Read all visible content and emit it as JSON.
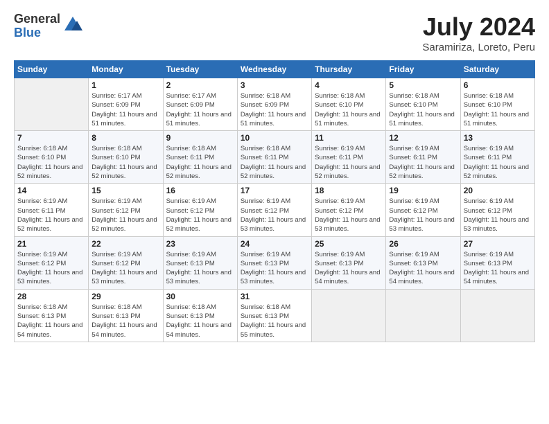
{
  "header": {
    "logo_general": "General",
    "logo_blue": "Blue",
    "month_title": "July 2024",
    "location": "Saramiriza, Loreto, Peru"
  },
  "weekdays": [
    "Sunday",
    "Monday",
    "Tuesday",
    "Wednesday",
    "Thursday",
    "Friday",
    "Saturday"
  ],
  "weeks": [
    [
      {
        "day": "",
        "empty": true
      },
      {
        "day": "1",
        "sunrise": "Sunrise: 6:17 AM",
        "sunset": "Sunset: 6:09 PM",
        "daylight": "Daylight: 11 hours and 51 minutes."
      },
      {
        "day": "2",
        "sunrise": "Sunrise: 6:17 AM",
        "sunset": "Sunset: 6:09 PM",
        "daylight": "Daylight: 11 hours and 51 minutes."
      },
      {
        "day": "3",
        "sunrise": "Sunrise: 6:18 AM",
        "sunset": "Sunset: 6:09 PM",
        "daylight": "Daylight: 11 hours and 51 minutes."
      },
      {
        "day": "4",
        "sunrise": "Sunrise: 6:18 AM",
        "sunset": "Sunset: 6:10 PM",
        "daylight": "Daylight: 11 hours and 51 minutes."
      },
      {
        "day": "5",
        "sunrise": "Sunrise: 6:18 AM",
        "sunset": "Sunset: 6:10 PM",
        "daylight": "Daylight: 11 hours and 51 minutes."
      },
      {
        "day": "6",
        "sunrise": "Sunrise: 6:18 AM",
        "sunset": "Sunset: 6:10 PM",
        "daylight": "Daylight: 11 hours and 51 minutes."
      }
    ],
    [
      {
        "day": "7",
        "sunrise": "Sunrise: 6:18 AM",
        "sunset": "Sunset: 6:10 PM",
        "daylight": "Daylight: 11 hours and 52 minutes."
      },
      {
        "day": "8",
        "sunrise": "Sunrise: 6:18 AM",
        "sunset": "Sunset: 6:10 PM",
        "daylight": "Daylight: 11 hours and 52 minutes."
      },
      {
        "day": "9",
        "sunrise": "Sunrise: 6:18 AM",
        "sunset": "Sunset: 6:11 PM",
        "daylight": "Daylight: 11 hours and 52 minutes."
      },
      {
        "day": "10",
        "sunrise": "Sunrise: 6:18 AM",
        "sunset": "Sunset: 6:11 PM",
        "daylight": "Daylight: 11 hours and 52 minutes."
      },
      {
        "day": "11",
        "sunrise": "Sunrise: 6:19 AM",
        "sunset": "Sunset: 6:11 PM",
        "daylight": "Daylight: 11 hours and 52 minutes."
      },
      {
        "day": "12",
        "sunrise": "Sunrise: 6:19 AM",
        "sunset": "Sunset: 6:11 PM",
        "daylight": "Daylight: 11 hours and 52 minutes."
      },
      {
        "day": "13",
        "sunrise": "Sunrise: 6:19 AM",
        "sunset": "Sunset: 6:11 PM",
        "daylight": "Daylight: 11 hours and 52 minutes."
      }
    ],
    [
      {
        "day": "14",
        "sunrise": "Sunrise: 6:19 AM",
        "sunset": "Sunset: 6:11 PM",
        "daylight": "Daylight: 11 hours and 52 minutes."
      },
      {
        "day": "15",
        "sunrise": "Sunrise: 6:19 AM",
        "sunset": "Sunset: 6:12 PM",
        "daylight": "Daylight: 11 hours and 52 minutes."
      },
      {
        "day": "16",
        "sunrise": "Sunrise: 6:19 AM",
        "sunset": "Sunset: 6:12 PM",
        "daylight": "Daylight: 11 hours and 52 minutes."
      },
      {
        "day": "17",
        "sunrise": "Sunrise: 6:19 AM",
        "sunset": "Sunset: 6:12 PM",
        "daylight": "Daylight: 11 hours and 53 minutes."
      },
      {
        "day": "18",
        "sunrise": "Sunrise: 6:19 AM",
        "sunset": "Sunset: 6:12 PM",
        "daylight": "Daylight: 11 hours and 53 minutes."
      },
      {
        "day": "19",
        "sunrise": "Sunrise: 6:19 AM",
        "sunset": "Sunset: 6:12 PM",
        "daylight": "Daylight: 11 hours and 53 minutes."
      },
      {
        "day": "20",
        "sunrise": "Sunrise: 6:19 AM",
        "sunset": "Sunset: 6:12 PM",
        "daylight": "Daylight: 11 hours and 53 minutes."
      }
    ],
    [
      {
        "day": "21",
        "sunrise": "Sunrise: 6:19 AM",
        "sunset": "Sunset: 6:12 PM",
        "daylight": "Daylight: 11 hours and 53 minutes."
      },
      {
        "day": "22",
        "sunrise": "Sunrise: 6:19 AM",
        "sunset": "Sunset: 6:12 PM",
        "daylight": "Daylight: 11 hours and 53 minutes."
      },
      {
        "day": "23",
        "sunrise": "Sunrise: 6:19 AM",
        "sunset": "Sunset: 6:13 PM",
        "daylight": "Daylight: 11 hours and 53 minutes."
      },
      {
        "day": "24",
        "sunrise": "Sunrise: 6:19 AM",
        "sunset": "Sunset: 6:13 PM",
        "daylight": "Daylight: 11 hours and 53 minutes."
      },
      {
        "day": "25",
        "sunrise": "Sunrise: 6:19 AM",
        "sunset": "Sunset: 6:13 PM",
        "daylight": "Daylight: 11 hours and 54 minutes."
      },
      {
        "day": "26",
        "sunrise": "Sunrise: 6:19 AM",
        "sunset": "Sunset: 6:13 PM",
        "daylight": "Daylight: 11 hours and 54 minutes."
      },
      {
        "day": "27",
        "sunrise": "Sunrise: 6:19 AM",
        "sunset": "Sunset: 6:13 PM",
        "daylight": "Daylight: 11 hours and 54 minutes."
      }
    ],
    [
      {
        "day": "28",
        "sunrise": "Sunrise: 6:18 AM",
        "sunset": "Sunset: 6:13 PM",
        "daylight": "Daylight: 11 hours and 54 minutes."
      },
      {
        "day": "29",
        "sunrise": "Sunrise: 6:18 AM",
        "sunset": "Sunset: 6:13 PM",
        "daylight": "Daylight: 11 hours and 54 minutes."
      },
      {
        "day": "30",
        "sunrise": "Sunrise: 6:18 AM",
        "sunset": "Sunset: 6:13 PM",
        "daylight": "Daylight: 11 hours and 54 minutes."
      },
      {
        "day": "31",
        "sunrise": "Sunrise: 6:18 AM",
        "sunset": "Sunset: 6:13 PM",
        "daylight": "Daylight: 11 hours and 55 minutes."
      },
      {
        "day": "",
        "empty": true
      },
      {
        "day": "",
        "empty": true
      },
      {
        "day": "",
        "empty": true
      }
    ]
  ]
}
